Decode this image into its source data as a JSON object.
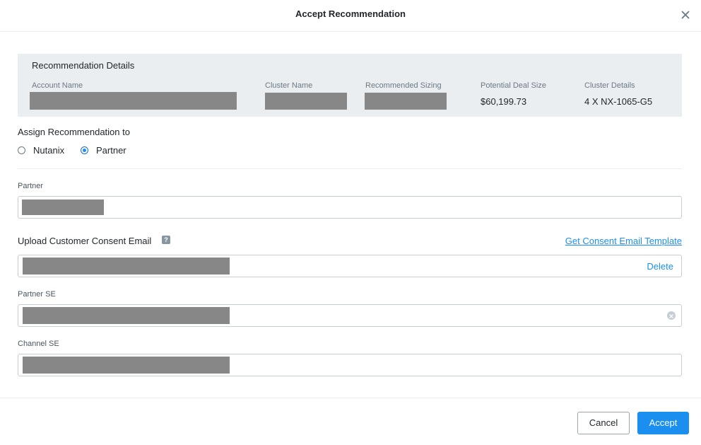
{
  "header": {
    "title": "Accept Recommendation",
    "close_icon": "close-icon"
  },
  "details": {
    "title": "Recommendation Details",
    "columns": [
      {
        "label": "Account Name",
        "value": ""
      },
      {
        "label": "Cluster Name",
        "value": ""
      },
      {
        "label": "Recommended Sizing",
        "value": ""
      },
      {
        "label": "Potential Deal Size",
        "value": "$60,199.73"
      },
      {
        "label": "Cluster Details",
        "value": "4 X NX-1065-G5"
      }
    ]
  },
  "assign": {
    "label": "Assign Recommendation to",
    "options": [
      {
        "label": "Nutanix",
        "selected": false
      },
      {
        "label": "Partner",
        "selected": true
      }
    ]
  },
  "partner": {
    "label": "Partner",
    "value": ""
  },
  "upload": {
    "label": "Upload Customer Consent Email",
    "help_icon": "help-icon",
    "template_link": "Get Consent Email Template",
    "delete_label": "Delete",
    "file_value": ""
  },
  "partner_se": {
    "label": "Partner SE",
    "value": "",
    "clear_icon": "clear-icon"
  },
  "channel_se": {
    "label": "Channel SE",
    "value": ""
  },
  "footer": {
    "cancel_label": "Cancel",
    "accept_label": "Accept"
  },
  "colors": {
    "accent": "#1b8ff0",
    "panel_bg": "#ebeef1",
    "redacted": "#878787"
  }
}
